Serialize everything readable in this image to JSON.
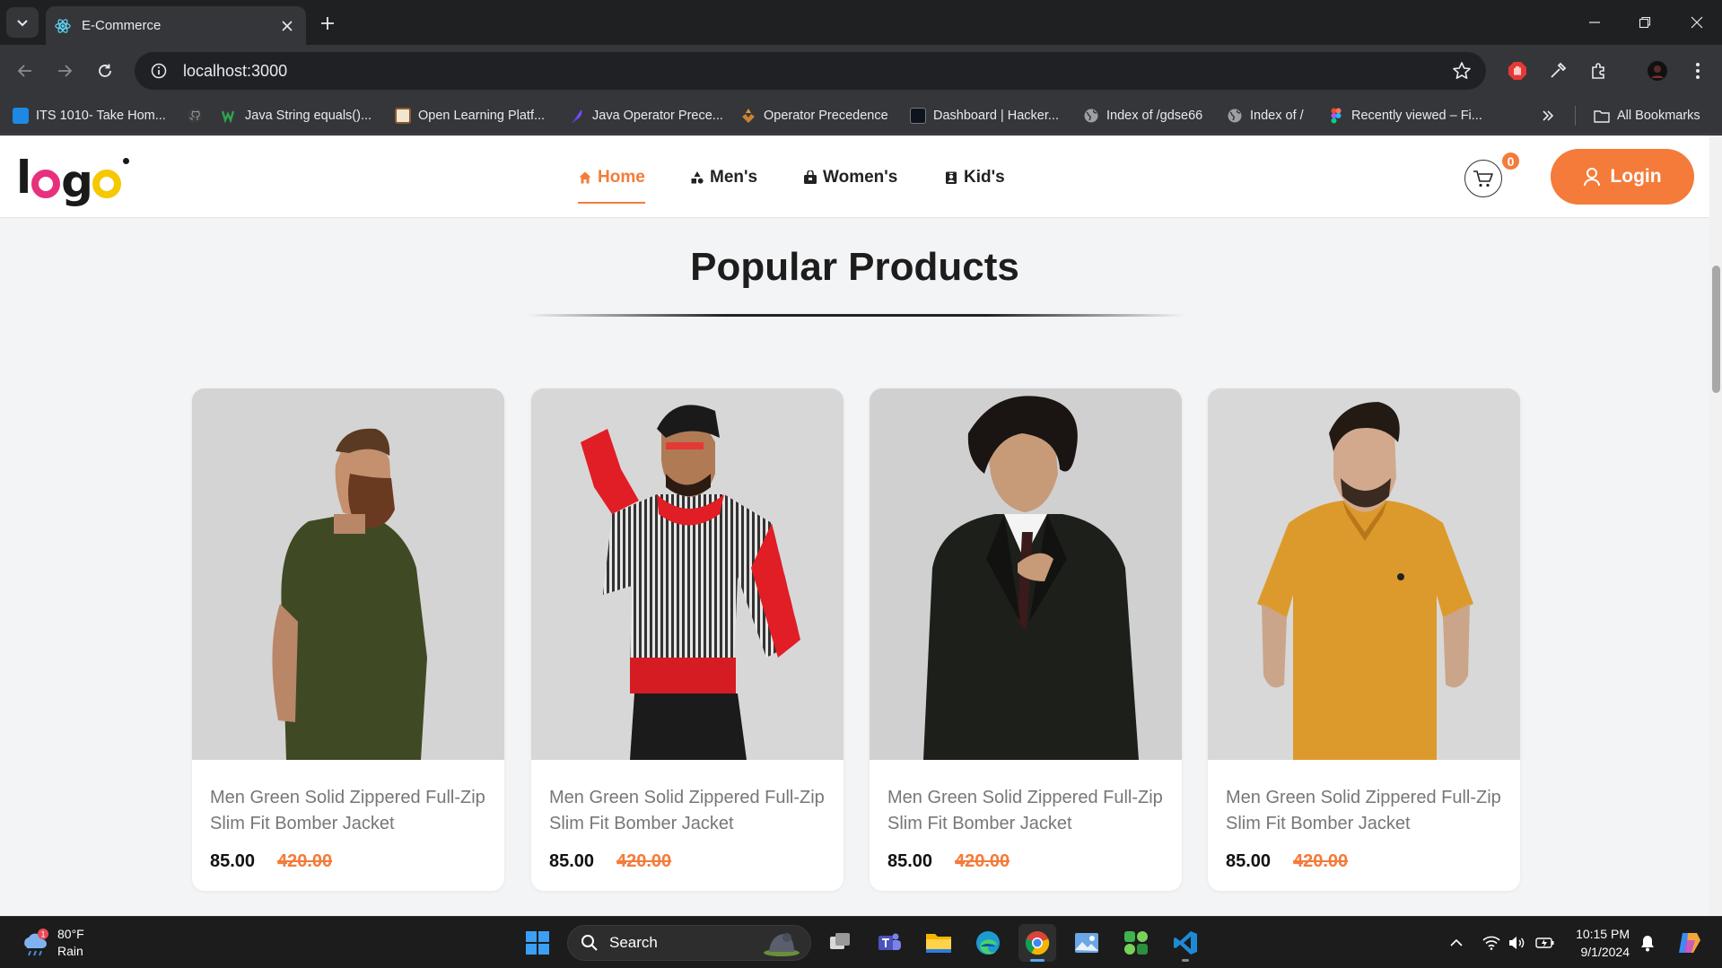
{
  "browser": {
    "tab_title": "E-Commerce",
    "url": "localhost:3000",
    "bookmarks": [
      {
        "label": "ITS 1010- Take Hom...",
        "icon": "classroom-icon"
      },
      {
        "label": "",
        "icon": "github-icon"
      },
      {
        "label": "Java String equals()...",
        "icon": "w3-icon"
      },
      {
        "label": "Open Learning Platf...",
        "icon": "openlearning-icon"
      },
      {
        "label": "Java Operator Prece...",
        "icon": "feather-icon"
      },
      {
        "label": "Operator Precedence",
        "icon": "precedence-icon"
      },
      {
        "label": "Dashboard | Hacker...",
        "icon": "hackerrank-icon"
      },
      {
        "label": "Index of /gdse66",
        "icon": "globe-icon"
      },
      {
        "label": "Index of /",
        "icon": "globe-icon"
      },
      {
        "label": "Recently viewed – Fi...",
        "icon": "figma-icon"
      }
    ],
    "all_bookmarks": "All Bookmarks"
  },
  "site": {
    "logo": "logo",
    "nav": [
      {
        "label": "Home",
        "icon": "home-icon",
        "active": true
      },
      {
        "label": "Men's",
        "icon": "shapes-icon",
        "active": false
      },
      {
        "label": "Women's",
        "icon": "bag-icon",
        "active": false
      },
      {
        "label": "Kid's",
        "icon": "badge-icon",
        "active": false
      }
    ],
    "cart_count": "0",
    "login_label": "Login",
    "section_title": "Popular Products",
    "products": [
      {
        "name": "Men Green Solid Zippered Full-Zip Slim Fit Bomber Jacket",
        "price": "85.00",
        "old_price": "420.00",
        "image": "bearded man in green t-shirt"
      },
      {
        "name": "Men Green Solid Zippered Full-Zip Slim Fit Bomber Jacket",
        "price": "85.00",
        "old_price": "420.00",
        "image": "man in striped red hoodie"
      },
      {
        "name": "Men Green Solid Zippered Full-Zip Slim Fit Bomber Jacket",
        "price": "85.00",
        "old_price": "420.00",
        "image": "man in black suit"
      },
      {
        "name": "Men Green Solid Zippered Full-Zip Slim Fit Bomber Jacket",
        "price": "85.00",
        "old_price": "420.00",
        "image": "man in mustard polo shirt"
      }
    ]
  },
  "taskbar": {
    "weather_temp": "80°F",
    "weather_desc": "Rain",
    "weather_badge": "1",
    "search_label": "Search",
    "time": "10:15 PM",
    "date": "9/1/2024"
  },
  "colors": {
    "accent": "#f47b3a",
    "page_bg": "#f3f4f6",
    "chrome_bg": "#35363a"
  }
}
